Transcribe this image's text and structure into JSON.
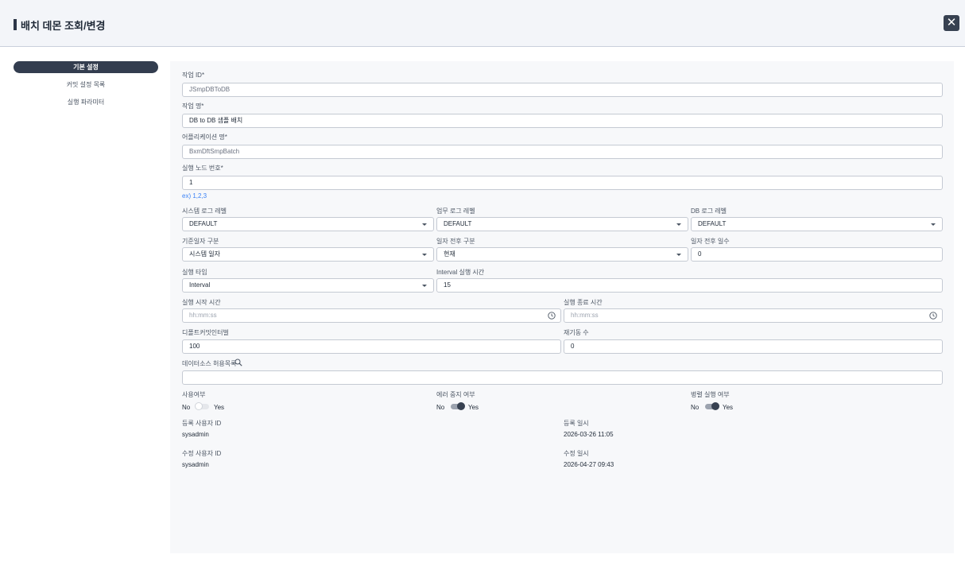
{
  "header": {
    "title": "배치 데몬 조회/변경",
    "close_icon": "close-icon"
  },
  "sidebar": {
    "items": [
      {
        "label": "기본 설정",
        "active": true
      },
      {
        "label": "커밋 설정 목록",
        "active": false
      },
      {
        "label": "실행 파라미터",
        "active": false
      }
    ]
  },
  "form": {
    "job_id": {
      "label": "작업 ID*",
      "value": "JSmpDBToDB"
    },
    "job_name": {
      "label": "작업 명*",
      "value": "DB to DB 샘플 배치"
    },
    "app_name": {
      "label": "어플리케이션 명*",
      "value": "BxmDftSmpBatch"
    },
    "node_no": {
      "label": "실행 노드 번호*",
      "value": "1",
      "hint": "ex) 1,2,3"
    },
    "sys_log": {
      "label": "시스템 로그 레벨",
      "value": "DEFAULT"
    },
    "biz_log": {
      "label": "업무 로그 레벨",
      "value": "DEFAULT"
    },
    "db_log": {
      "label": "DB 로그 레벨",
      "value": "DEFAULT"
    },
    "base_date": {
      "label": "기준일자 구분",
      "value": "시스템 일자"
    },
    "date_shift": {
      "label": "일자 전후 구분",
      "value": "현재"
    },
    "date_days": {
      "label": "일자 전후 일수",
      "value": "0"
    },
    "run_type": {
      "label": "실행 타입",
      "value": "Interval"
    },
    "interval": {
      "label": "Interval 실행 시간",
      "value": "15"
    },
    "start_time": {
      "label": "실행 시작 시간",
      "placeholder": "hh:mm:ss"
    },
    "end_time": {
      "label": "실행 종료 시간",
      "placeholder": "hh:mm:ss"
    },
    "commit_interval": {
      "label": "디폴트커밋인터벌",
      "value": "100"
    },
    "restart_count": {
      "label": "재기동 수",
      "value": "0"
    },
    "datasource": {
      "label": "데이터소스 허용목록",
      "value": ""
    },
    "use_yn": {
      "label": "사용여부",
      "no": "No",
      "yes": "Yes",
      "on": false
    },
    "error_stop": {
      "label": "에러 중지 여부",
      "no": "No",
      "yes": "Yes",
      "on": true
    },
    "parallel": {
      "label": "병렬 실행 여부",
      "no": "No",
      "yes": "Yes",
      "on": true
    },
    "reg_user": {
      "label": "등록 사용자 ID",
      "value": "sysadmin"
    },
    "reg_date": {
      "label": "등록 일시",
      "value": "2026-03-26 11:05"
    },
    "mod_user": {
      "label": "수정 사용자 ID",
      "value": "sysadmin"
    },
    "mod_date": {
      "label": "수정 일시",
      "value": "2026-04-27 09:43"
    }
  }
}
